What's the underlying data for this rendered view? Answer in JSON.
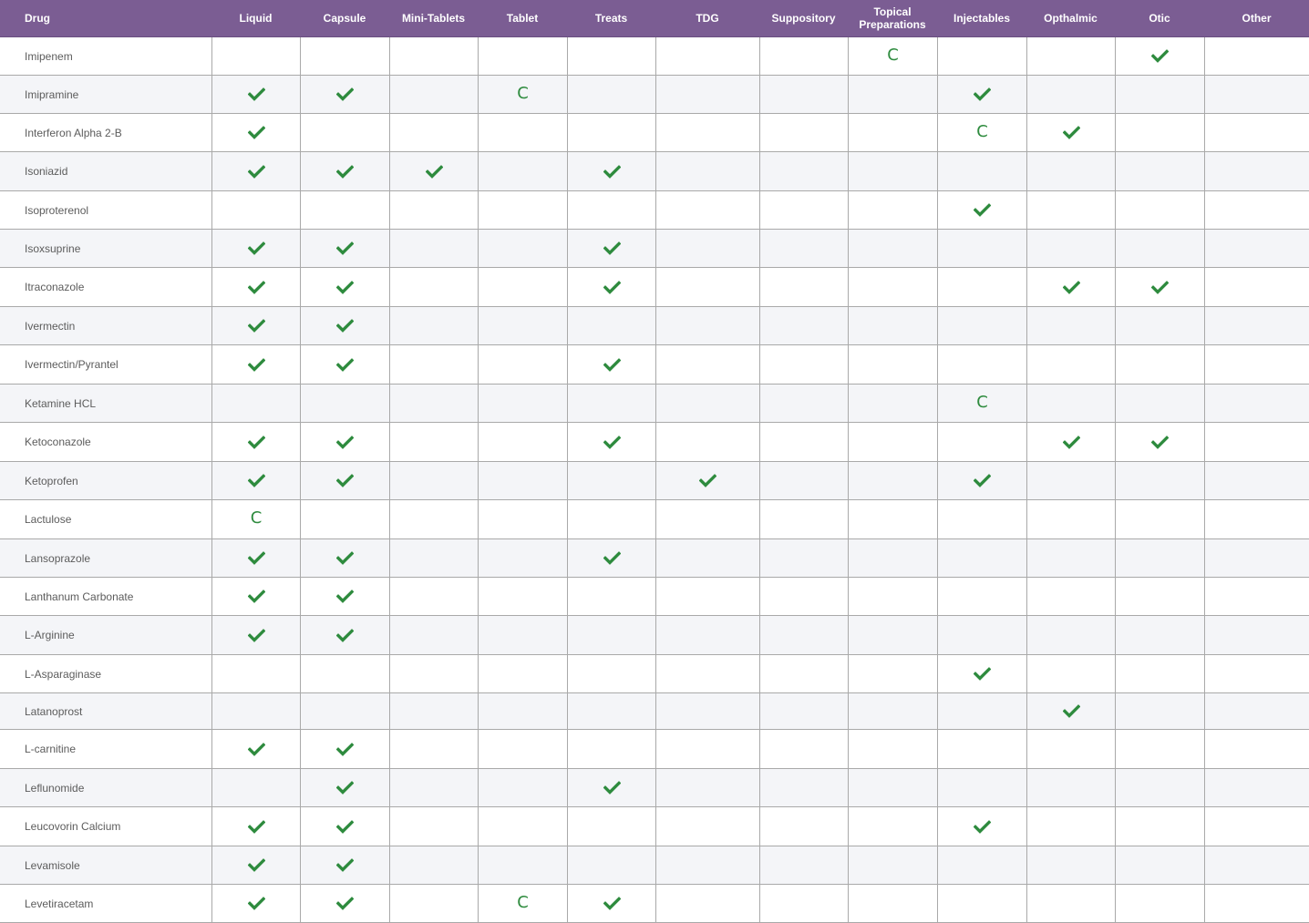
{
  "table": {
    "columns": [
      "Drug",
      "Liquid",
      "Capsule",
      "Mini-Tablets",
      "Tablet",
      "Treats",
      "TDG",
      "Suppository",
      "Topical Preparations",
      "Injectables",
      "Opthalmic",
      "Otic",
      "Other"
    ],
    "check_icon": "check-icon",
    "colors": {
      "header_background": "#7b5d93",
      "check": "#2e8b3e",
      "striped_row": "#f4f5f8",
      "grid": "#a9a9a9"
    },
    "rows": [
      {
        "drug": "Imipenem",
        "cells": [
          "",
          "",
          "",
          "",
          "",
          "",
          "",
          "C",
          "",
          "",
          "check",
          ""
        ]
      },
      {
        "drug": "Imipramine",
        "cells": [
          "check",
          "check",
          "",
          "C",
          "",
          "",
          "",
          "",
          "check",
          "",
          "",
          ""
        ]
      },
      {
        "drug": "Interferon Alpha 2-B",
        "cells": [
          "check",
          "",
          "",
          "",
          "",
          "",
          "",
          "",
          "C",
          "check",
          "",
          ""
        ]
      },
      {
        "drug": "Isoniazid",
        "cells": [
          "check",
          "check",
          "check",
          "",
          "check",
          "",
          "",
          "",
          "",
          "",
          "",
          ""
        ]
      },
      {
        "drug": "Isoproterenol",
        "cells": [
          "",
          "",
          "",
          "",
          "",
          "",
          "",
          "",
          "check",
          "",
          "",
          ""
        ]
      },
      {
        "drug": "Isoxsuprine",
        "cells": [
          "check",
          "check",
          "",
          "",
          "check",
          "",
          "",
          "",
          "",
          "",
          "",
          ""
        ]
      },
      {
        "drug": "Itraconazole",
        "cells": [
          "check",
          "check",
          "",
          "",
          "check",
          "",
          "",
          "",
          "",
          "check",
          "check",
          ""
        ]
      },
      {
        "drug": "Ivermectin",
        "cells": [
          "check",
          "check",
          "",
          "",
          "",
          "",
          "",
          "",
          "",
          "",
          "",
          ""
        ]
      },
      {
        "drug": "Ivermectin/Pyrantel",
        "cells": [
          "check",
          "check",
          "",
          "",
          "check",
          "",
          "",
          "",
          "",
          "",
          "",
          ""
        ]
      },
      {
        "drug": "Ketamine HCL",
        "cells": [
          "",
          "",
          "",
          "",
          "",
          "",
          "",
          "",
          "C",
          "",
          "",
          ""
        ]
      },
      {
        "drug": "Ketoconazole",
        "cells": [
          "check",
          "check",
          "",
          "",
          "check",
          "",
          "",
          "",
          "",
          "check",
          "check",
          ""
        ]
      },
      {
        "drug": "Ketoprofen",
        "cells": [
          "check",
          "check",
          "",
          "",
          "",
          "check",
          "",
          "",
          "check",
          "",
          "",
          ""
        ]
      },
      {
        "drug": "Lactulose",
        "cells": [
          "C",
          "",
          "",
          "",
          "",
          "",
          "",
          "",
          "",
          "",
          "",
          ""
        ]
      },
      {
        "drug": "Lansoprazole",
        "cells": [
          "check",
          "check",
          "",
          "",
          "check",
          "",
          "",
          "",
          "",
          "",
          "",
          ""
        ]
      },
      {
        "drug": "Lanthanum Carbonate",
        "cells": [
          "check",
          "check",
          "",
          "",
          "",
          "",
          "",
          "",
          "",
          "",
          "",
          ""
        ]
      },
      {
        "drug": "L-Arginine",
        "cells": [
          "check",
          "check",
          "",
          "",
          "",
          "",
          "",
          "",
          "",
          "",
          "",
          ""
        ]
      },
      {
        "drug": "L-Asparaginase",
        "cells": [
          "",
          "",
          "",
          "",
          "",
          "",
          "",
          "",
          "check",
          "",
          "",
          ""
        ]
      },
      {
        "drug": "Latanoprost",
        "cells": [
          "",
          "",
          "",
          "",
          "",
          "",
          "",
          "",
          "",
          "check",
          "",
          ""
        ]
      },
      {
        "drug": "L-carnitine",
        "cells": [
          "check",
          "check",
          "",
          "",
          "",
          "",
          "",
          "",
          "",
          "",
          "",
          ""
        ]
      },
      {
        "drug": "Leflunomide",
        "cells": [
          "",
          "check",
          "",
          "",
          "check",
          "",
          "",
          "",
          "",
          "",
          "",
          ""
        ]
      },
      {
        "drug": "Leucovorin Calcium",
        "cells": [
          "check",
          "check",
          "",
          "",
          "",
          "",
          "",
          "",
          "check",
          "",
          "",
          ""
        ]
      },
      {
        "drug": "Levamisole",
        "cells": [
          "check",
          "check",
          "",
          "",
          "",
          "",
          "",
          "",
          "",
          "",
          "",
          ""
        ]
      },
      {
        "drug": "Levetiracetam",
        "cells": [
          "check",
          "check",
          "",
          "C",
          "check",
          "",
          "",
          "",
          "",
          "",
          "",
          ""
        ]
      }
    ]
  }
}
